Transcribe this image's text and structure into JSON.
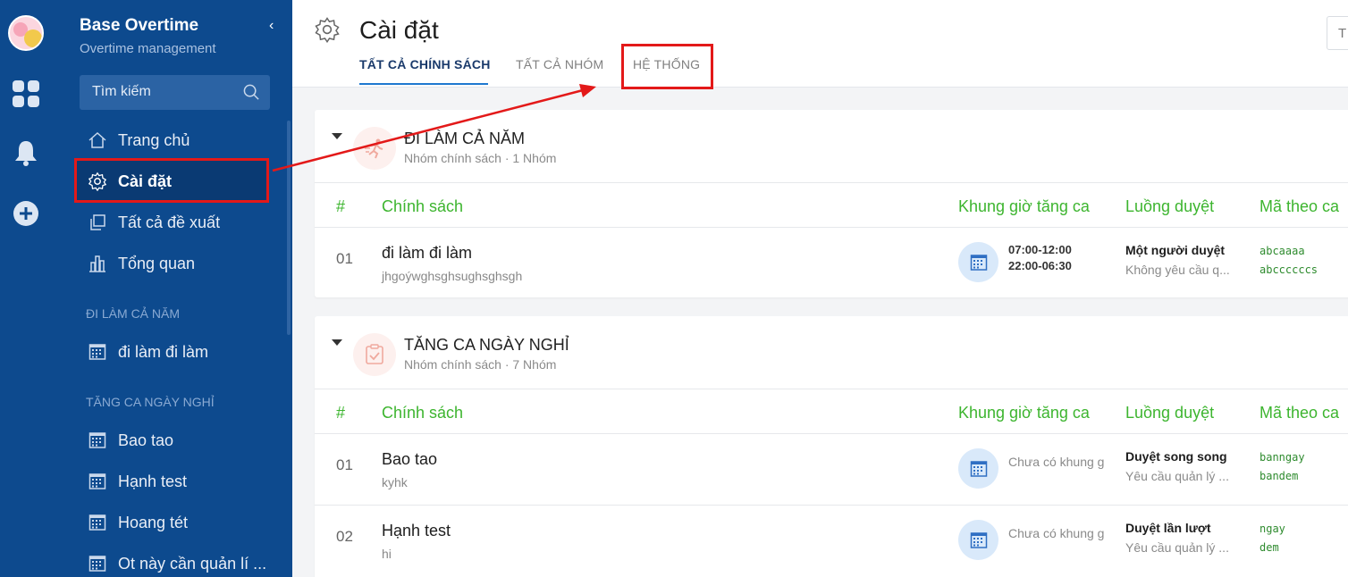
{
  "app": {
    "title": "Base Overtime",
    "subtitle": "Overtime management",
    "collapse_glyph": "‹"
  },
  "sidebar": {
    "search_placeholder": "Tìm kiếm",
    "nav": [
      {
        "label": "Trang chủ",
        "icon": "home-icon"
      },
      {
        "label": "Cài đặt",
        "icon": "gear-icon",
        "active": true
      },
      {
        "label": "Tất cả đề xuất",
        "icon": "copy-icon"
      },
      {
        "label": "Tổng quan",
        "icon": "bar-chart-icon"
      }
    ],
    "sections": [
      {
        "title": "ĐI LÀM CẢ NĂM",
        "items": [
          "đi làm đi làm"
        ]
      },
      {
        "title": "TĂNG CA NGÀY NGHỈ",
        "items": [
          "Bao tao",
          "Hạnh test",
          "Hoang tét",
          "Ot này cần quản lí ..."
        ]
      }
    ]
  },
  "header": {
    "title": "Cài đặt",
    "tabs": [
      "TẤT CẢ CHÍNH SÁCH",
      "TẤT CẢ NHÓM",
      "HỆ THỐNG"
    ],
    "active_tab": 0,
    "top_right_field": "T"
  },
  "columns": {
    "num": "#",
    "policy": "Chính sách",
    "shift": "Khung giờ tăng ca",
    "flow": "Luồng duyệt",
    "code": "Mã theo ca"
  },
  "groups": [
    {
      "name": "ĐI LÀM CẢ NĂM",
      "meta": "Nhóm chính sách · 1 Nhóm",
      "rows": [
        {
          "num": "01",
          "name": "đi làm đi làm",
          "desc": "jhgoýwghsghsughsghsgh",
          "shifts": [
            "07:00-12:00",
            "22:00-06:30"
          ],
          "flow": "Một người duyệt",
          "flow_sub": "Không yêu cầu q...",
          "codes": [
            "abcaaaa",
            "abccccccs"
          ]
        }
      ]
    },
    {
      "name": "TĂNG CA NGÀY NGHỈ",
      "meta": "Nhóm chính sách · 7 Nhóm",
      "rows": [
        {
          "num": "01",
          "name": "Bao tao",
          "desc": "kyhk",
          "shift_empty": "Chưa có khung giờ",
          "flow": "Duyệt song song",
          "flow_sub": "Yêu cầu quản lý ...",
          "codes": [
            "banngay",
            "bandem"
          ]
        },
        {
          "num": "02",
          "name": "Hạnh test",
          "desc": "hi",
          "shift_empty": "Chưa có khung giờ",
          "flow": "Duyệt lần lượt",
          "flow_sub": "Yêu cầu quản lý ...",
          "codes": [
            "ngay",
            "dem"
          ]
        }
      ]
    }
  ],
  "colors": {
    "sidebar_bg": "#0d4a8e",
    "accent_green": "#3db52f",
    "highlight_red": "#e31919",
    "tab_underline": "#1e78d0"
  }
}
